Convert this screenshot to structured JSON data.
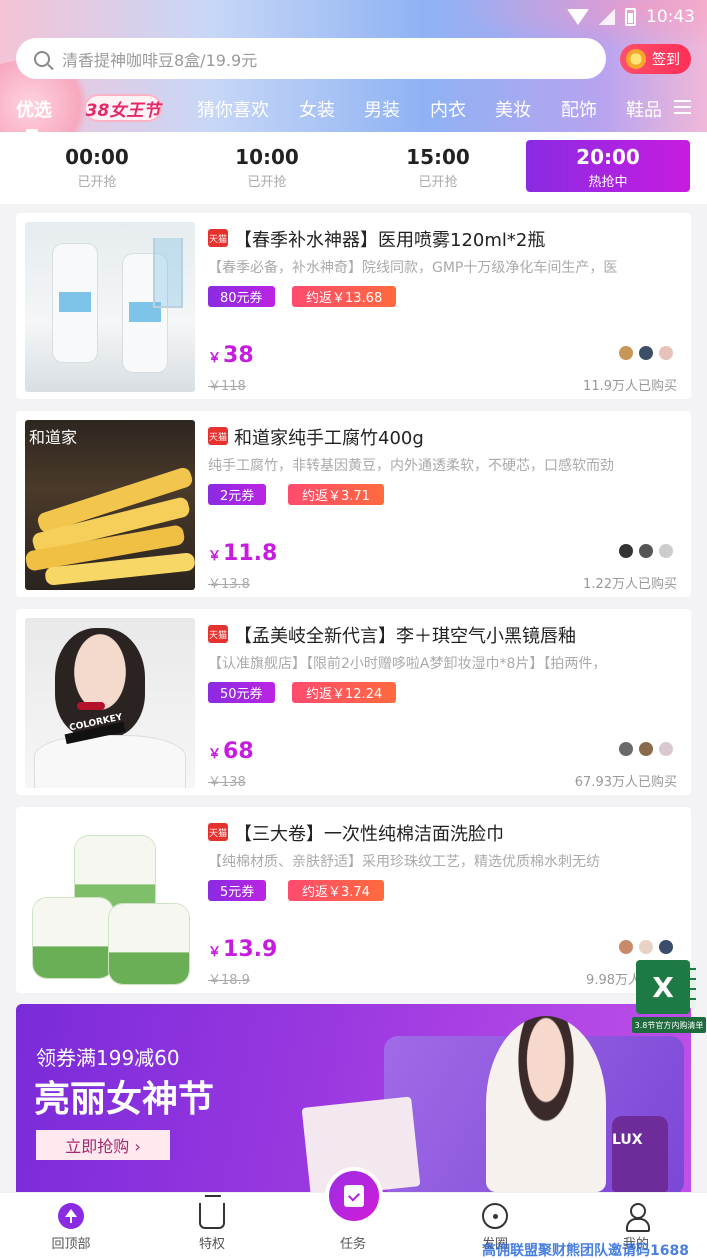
{
  "status_bar": {
    "time": "10:43"
  },
  "search": {
    "placeholder": "清香提神咖啡豆8盒/19.9元"
  },
  "signin": {
    "label": "签到"
  },
  "tabs": {
    "first": "优选",
    "promo": "38女王节",
    "items": [
      "猜你喜欢",
      "女装",
      "男装",
      "内衣",
      "美妆",
      "配饰",
      "鞋品"
    ]
  },
  "time_slots": [
    {
      "time": "00:00",
      "status": "已开抢"
    },
    {
      "time": "10:00",
      "status": "已开抢"
    },
    {
      "time": "15:00",
      "status": "已开抢"
    },
    {
      "time": "20:00",
      "status": "热抢中",
      "active": true
    }
  ],
  "products": [
    {
      "tag": "天猫",
      "title": "【春季补水神器】医用喷雾120ml*2瓶",
      "desc": "【春季必备，补水神奇】院线同款，GMP十万级净化车间生产，医",
      "coupon": "80元券",
      "rebate": "约返￥13.68",
      "currency": "￥",
      "price": "38",
      "orig_price": "￥118",
      "sold": "11.9万人已购买"
    },
    {
      "tag": "天猫",
      "title": "和道家纯手工腐竹400g",
      "desc": "纯手工腐竹，非转基因黄豆，内外通透柔软，不硬芯，口感软而劲",
      "coupon": "2元券",
      "rebate": "约返￥3.71",
      "currency": "￥",
      "price": "11.8",
      "orig_price": "￥13.8",
      "sold": "1.22万人已购买",
      "thumb_text": "和道家"
    },
    {
      "tag": "天猫",
      "title": "【孟美岐全新代言】李＋琪空气小黑镜唇釉",
      "desc": "【认准旗舰店】【限前2小时赠哆啦A梦卸妆湿巾*8片】【拍两件，",
      "coupon": "50元券",
      "rebate": "约返￥12.24",
      "currency": "￥",
      "price": "68",
      "orig_price": "￥138",
      "sold": "67.93万人已购买",
      "thumb_text": "COLORKEY"
    },
    {
      "tag": "天猫",
      "title": "【三大卷】一次性纯棉洁面洗脸巾",
      "desc": "【纯棉材质、亲肤舒适】采用珍珠纹工艺，精选优质棉水刺无纺",
      "coupon": "5元券",
      "rebate": "约返￥3.74",
      "currency": "￥",
      "price": "13.9",
      "orig_price": "￥18.9",
      "sold": "9.98万人"
    }
  ],
  "banner": {
    "line1": "领券满199减60",
    "line2": "亮丽女神节",
    "button": "立即抢购 ›",
    "tag": "LUX"
  },
  "floating_excel": {
    "letter": "X",
    "caption": "3.8节官方内购清单"
  },
  "bottom_nav": [
    {
      "label": "回顶部",
      "icon": "arrow-up-icon"
    },
    {
      "label": "特权",
      "icon": "crown-icon"
    },
    {
      "label": "任务",
      "icon": "task-icon"
    },
    {
      "label": "发圈",
      "icon": "compass-icon"
    },
    {
      "label": "我的",
      "icon": "user-icon"
    }
  ],
  "watermark": "高佣联盟聚财熊团队邀请码1688"
}
